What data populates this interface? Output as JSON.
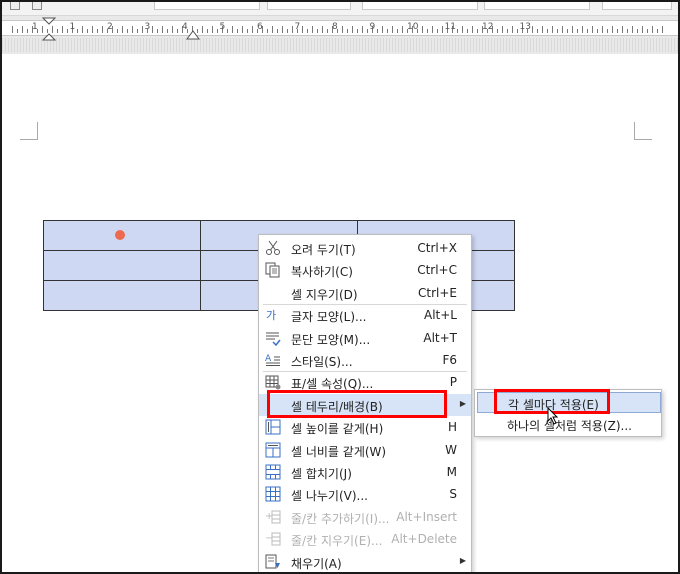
{
  "ruler": {
    "numbers": [
      "1",
      "1",
      "2",
      "3",
      "4",
      "5",
      "6",
      "7",
      "8",
      "9",
      "10",
      "11",
      "12",
      "13"
    ]
  },
  "colors": {
    "table_fill": "#cfd8f3",
    "highlight_box": "#ff0000",
    "selected_item": "#d7e3f7",
    "dot": "#ee6a4e"
  },
  "table": {
    "rows": 3,
    "cols": 3
  },
  "context_menu": {
    "items": [
      {
        "icon": "scissors-icon",
        "label": "오려 두기(T)",
        "shortcut": "Ctrl+X"
      },
      {
        "icon": "copy-icon",
        "label": "복사하기(C)",
        "shortcut": "Ctrl+C"
      },
      {
        "icon": "",
        "label": "셀 지우기(D)",
        "shortcut": "Ctrl+E"
      },
      {
        "icon": "font-shape-icon",
        "label": "글자 모양(L)...",
        "shortcut": "Alt+L"
      },
      {
        "icon": "paragraph-shape-icon",
        "label": "문단 모양(M)...",
        "shortcut": "Alt+T"
      },
      {
        "icon": "style-icon",
        "label": "스타일(S)...",
        "shortcut": "F6"
      },
      {
        "icon": "table-properties-icon",
        "label": "표/셀 속성(Q)...",
        "shortcut": "P"
      },
      {
        "icon": "",
        "label": "셀 테두리/배경(B)",
        "shortcut": ""
      },
      {
        "icon": "equal-height-icon",
        "label": "셀 높이를 같게(H)",
        "shortcut": "H"
      },
      {
        "icon": "equal-width-icon",
        "label": "셀 너비를 같게(W)",
        "shortcut": "W"
      },
      {
        "icon": "merge-cells-icon",
        "label": "셀 합치기(J)",
        "shortcut": "M"
      },
      {
        "icon": "split-cells-icon",
        "label": "셀 나누기(V)...",
        "shortcut": "S"
      },
      {
        "icon": "insert-row-col-icon",
        "label": "줄/칸 추가하기(I)...",
        "shortcut": "Alt+Insert"
      },
      {
        "icon": "delete-row-col-icon",
        "label": "줄/칸 지우기(E)...",
        "shortcut": "Alt+Delete"
      },
      {
        "icon": "fill-icon",
        "label": "채우기(A)",
        "shortcut": ""
      }
    ]
  },
  "submenu": {
    "items": [
      {
        "label": "각 셀마다 적용(E)"
      },
      {
        "label": "하나의 셀처럼 적용(Z)..."
      }
    ]
  }
}
